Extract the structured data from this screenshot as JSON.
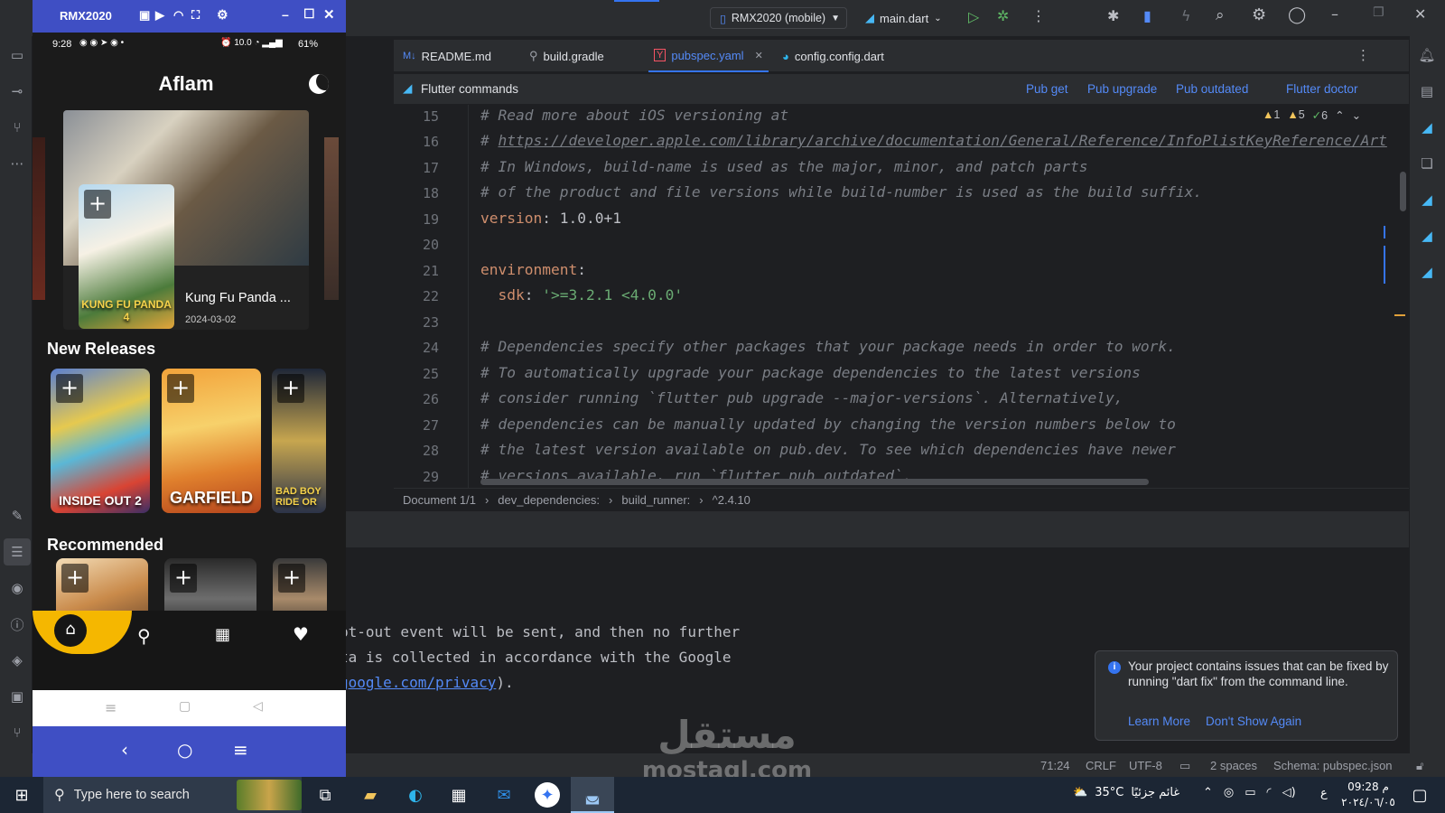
{
  "emulator": {
    "title": "RMX2020",
    "phone_status": {
      "time": "9:28",
      "net": "10.0",
      "battery": "61%"
    },
    "app_title": "Aflam",
    "featured": {
      "title": "Kung Fu Panda ...",
      "date": "2024-03-02",
      "poster_text": "KUNG FU PANDA 4"
    },
    "new_releases_title": "New Releases",
    "new_releases": [
      {
        "poster_text": "INSIDE OUT 2"
      },
      {
        "poster_text": "GARFIELD"
      },
      {
        "poster_text": "BAD BOY RIDE OR"
      }
    ],
    "recommended_title": "Recommended",
    "plus_label": "+",
    "nav_icons": [
      "home-icon",
      "search-icon",
      "movies-icon",
      "heart-icon"
    ]
  },
  "ide": {
    "device_selector": "RMX2020 (mobile)",
    "run_config": "main.dart",
    "tabs": [
      {
        "label": "README.md",
        "prefix": "M↓"
      },
      {
        "label": "build.gradle",
        "prefix": ""
      },
      {
        "label": "pubspec.yaml",
        "prefix": "Y",
        "active": true
      },
      {
        "label": "config.config.dart",
        "prefix": ""
      }
    ],
    "flutter_commands": {
      "label": "Flutter commands",
      "pub_get": "Pub get",
      "pub_upgrade": "Pub upgrade",
      "pub_outdated": "Pub outdated",
      "flutter_doctor": "Flutter doctor"
    },
    "inspections": {
      "errors": "1",
      "warnings": "5",
      "ok": "6"
    },
    "code": {
      "line_numbers": [
        "15",
        "16",
        "17",
        "18",
        "19",
        "20",
        "21",
        "22",
        "23",
        "24",
        "25",
        "26",
        "27",
        "28",
        "29"
      ],
      "l15": "# Read more about iOS versioning at",
      "l16_hash": "# ",
      "l16_url": "https://developer.apple.com/library/archive/documentation/General/Reference/InfoPlistKeyReference/Art",
      "l17": "# In Windows, build-name is used as the major, minor, and patch parts",
      "l18": "# of the product and file versions while build-number is used as the build suffix.",
      "l19_key": "version",
      "l19_val": ": 1.0.0+1",
      "l21_key": "environment",
      "l21_colon": ":",
      "l22_key": "  sdk",
      "l22_colon": ": ",
      "l22_val": "'>=3.2.1 <4.0.0'",
      "l24": "# Dependencies specify other packages that your package needs in order to work.",
      "l25": "# To automatically upgrade your package dependencies to the latest versions",
      "l26": "# consider running `flutter pub upgrade --major-versions`. Alternatively,",
      "l27": "# dependencies can be manually updated by changing the version numbers below to",
      "l28": "# the latest version available on pub.dev. To see which dependencies have newer",
      "l29": "# versions available, run `flutter pub outdated`."
    },
    "breadcrumb": [
      "Document 1/1",
      "dev_dependencies:",
      "build_runner:",
      "^2.4.10"
    ],
    "console": {
      "line1": "pt-out event will be sent, and then no further",
      "line2": "ta is collected in accordance with the Google",
      "line3_link": "google.com/privacy",
      "line3_rest": ")."
    },
    "notification": {
      "message": "Your project contains issues that can be fixed by running \"dart fix\" from the command line.",
      "learn_more": "Learn More",
      "dont_show": "Don't Show Again"
    },
    "status": {
      "position": "71:24",
      "line_sep": "CRLF",
      "encoding": "UTF-8",
      "indent": "2 spaces",
      "schema": "Schema: pubspec.json"
    }
  },
  "taskbar": {
    "search_placeholder": "Type here to search",
    "weather_temp": "35°C",
    "weather_desc": "غائم جزئيًا",
    "lang": "ع",
    "time": "09:28 م",
    "date": "٢٠٢٤/٠٦/٠٥"
  },
  "watermark": {
    "arabic": "مستقل",
    "latin": "mostaql.com"
  },
  "colors": {
    "accent": "#3574f0",
    "emulator_blue": "#3f4fc4",
    "link": "#548af7",
    "nav_yellow": "#f5b700"
  }
}
